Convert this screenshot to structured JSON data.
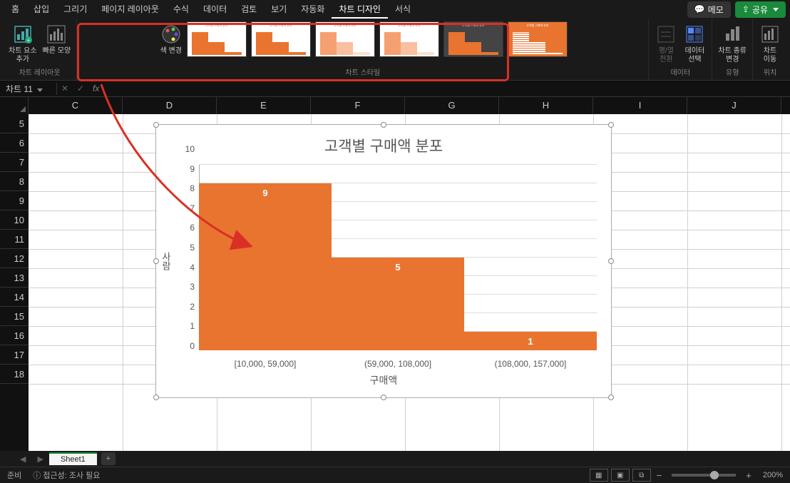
{
  "menu": {
    "tabs": [
      "홈",
      "삽입",
      "그리기",
      "페이지 레이아웃",
      "수식",
      "데이터",
      "검토",
      "보기",
      "자동화",
      "차트 디자인",
      "서식"
    ],
    "active_index": 9,
    "memo": "메모",
    "share": "공유"
  },
  "ribbon": {
    "layout": {
      "add_element": "차트 요소\n추가",
      "quick_layout": "빠른 모양",
      "label": "차트 레이아웃"
    },
    "colors": {
      "change_colors": "색 변경"
    },
    "styles": {
      "label": "차트 스타일"
    },
    "data": {
      "switch": "행/열\n전환",
      "select": "데이터\n선택",
      "label": "데이터"
    },
    "type": {
      "change_type": "차트 종류\n변경",
      "label": "유형"
    },
    "location": {
      "move": "차트\n이동",
      "label": "위치"
    }
  },
  "formula": {
    "namebox": "차트 11"
  },
  "grid": {
    "cols": [
      "C",
      "D",
      "E",
      "F",
      "G",
      "H",
      "I",
      "J"
    ],
    "rows": [
      "5",
      "6",
      "7",
      "8",
      "9",
      "10",
      "11",
      "12",
      "13",
      "14",
      "15",
      "16",
      "17",
      "18"
    ]
  },
  "chart_data": {
    "type": "bar",
    "title": "고객별 구매액 분포",
    "xlabel": "구매액",
    "ylabel": "사람",
    "categories": [
      "[10,000, 59,000]",
      "(59,000, 108,000]",
      "(108,000, 157,000]"
    ],
    "values": [
      9,
      5,
      1
    ],
    "ylim": [
      0,
      10
    ],
    "yticks": [
      0,
      1,
      2,
      3,
      4,
      5,
      6,
      7,
      8,
      9,
      10
    ]
  },
  "sheets": {
    "active": "Sheet1"
  },
  "status": {
    "ready": "준비",
    "accessibility": "접근성: 조사 필요",
    "zoom": "200%"
  }
}
